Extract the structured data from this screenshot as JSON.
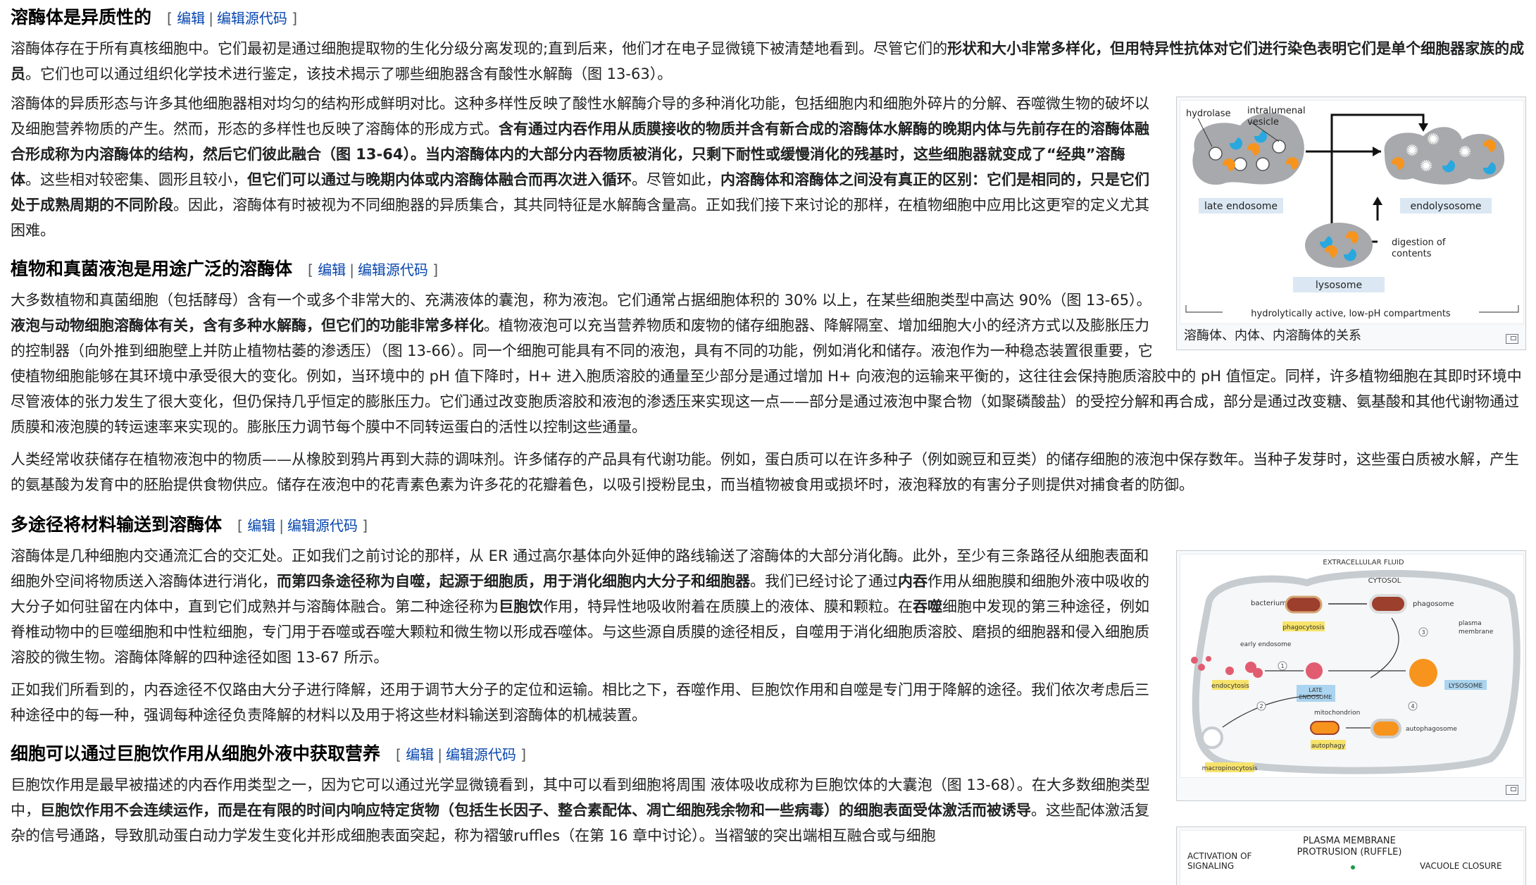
{
  "edit_links": {
    "edit": "编辑",
    "edit_source": "编辑源代码"
  },
  "sections": [
    {
      "title": "溶酶体是异质性的"
    },
    {
      "title": "植物和真菌液泡是用途广泛的溶酶体"
    },
    {
      "title": "多途径将材料输送到溶酶体"
    },
    {
      "title": "细胞可以通过巨胞饮作用从细胞外液中获取营养"
    }
  ],
  "s1": {
    "p1": [
      "溶酶体存在于所有真核细胞中。它们最初是通过细胞提取物的生化分级分离发现的;直到后来，他们才在电子显微镜下被清楚地看到。尽管它们的",
      "形状和大小非常多样化，但用特异性抗体对它们进行染色表明它们是单个细胞器家族的成员",
      "。它们也可以通过组织化学技术进行鉴定，该技术揭示了哪些细胞器含有酸性水解酶（图 13-63）。"
    ],
    "p2": [
      "溶酶体的异质形态与许多其他细胞器相对均匀的结构形成鲜明对比。这种多样性反映了酸性水解酶介导的多种消化功能，包括细胞内和细胞外碎片的分解、吞噬微生物的破坏以及细胞营养物质的产生。然而，形态的多样性也反映了溶酶体的形成方式。",
      "含有通过内吞作用从质膜接收的物质并含有新合成的溶酶体水解酶的晚期内体与先前存在的溶酶体融合形成称为内溶酶体的结构，然后它们彼此融合（图 13-64）。当内溶酶体内的大部分内吞物质被消化，只剩下耐性或缓慢消化的残基时，这些细胞器就变成了“经典”溶酶体",
      "。这些相对较密集、圆形且较小，",
      "但它们可以通过与晚期内体或内溶酶体融合而再次进入循环",
      "。尽管如此，",
      "内溶酶体和溶酶体之间没有真正的区别：它们是相同的，只是它们处于成熟周期的不同阶段",
      "。因此，溶酶体有时被视为不同细胞器的异质集合，其共同特征是水解酶含量高。正如我们接下来讨论的那样，在植物细胞中应用比这更窄的定义尤其困难。"
    ]
  },
  "fig1": {
    "caption": "溶酶体、内体、内溶酶体的关系",
    "labels": {
      "hydrolase": "hydrolase",
      "vesicle1": "intralumenal",
      "vesicle2": "vesicle",
      "late_endosome": "late endosome",
      "endolysosome": "endolysosome",
      "lysosome": "lysosome",
      "digestion1": "digestion of",
      "digestion2": "contents",
      "bottom": "hydrolytically active, low-pH compartments"
    },
    "colors": {
      "compartment": "#a7a9ac",
      "hydrolase_blue": "#29a8e0",
      "hydrolase_orange": "#f7941d",
      "label_bg": "#dbe8f3"
    }
  },
  "s2": {
    "p1": [
      "大多数植物和真菌细胞（包括酵母）含有一个或多个非常大的、充满液体的囊泡，称为液泡。它们通常占据细胞体积的 30% 以上，在某些细胞类型中高达 90%（图 13-65）。",
      "液泡与动物细胞溶酶体有关，含有多种水解酶，但它们的功能非常多样化",
      "。植物液泡可以充当营养物质和废物的储存细胞器、降解隔室、增加细胞大小的经济方式以及膨胀压力的控制器（向外推到细胞壁上并防止植物枯萎的渗透压）（图 13-66）。同一个细胞可能具有不同的液泡，具有不同的功能，例如消化和储存。液泡作为一种稳态装置很重要，它使植物细胞能够在其环境中承受很大的变化。例如，当环境中的 pH 值下降时，H+ 进入胞质溶胶的通量至少部分是通过增加 H+ 向液泡的运输来平衡的，这往往会保持胞质溶胶中的 pH 值恒定。同样，许多植物细胞在其即时环境中尽管液体的张力发生了很大变化，但仍保持几乎恒定的膨胀压力。它们通过改变胞质溶胶和液泡的渗透压来实现这一点——部分是通过液泡中聚合物（如聚磷酸盐）的受控分解和再合成，部分是通过改变糖、氨基酸和其他代谢物通过质膜和液泡膜的转运速率来实现的。膨胀压力调节每个膜中不同转运蛋白的活性以控制这些通量。"
    ],
    "p2": "人类经常收获储存在植物液泡中的物质——从橡胶到鸦片再到大蒜的调味剂。许多储存的产品具有代谢功能。例如，蛋白质可以在许多种子（例如豌豆和豆类）的储存细胞的液泡中保存数年。当种子发芽时，这些蛋白质被水解，产生的氨基酸为发育中的胚胎提供食物供应。储存在液泡中的花青素色素为许多花的花瓣着色，以吸引授粉昆虫，而当植物被食用或损坏时，液泡释放的有害分子则提供对捕食者的防御。"
  },
  "fig2": {
    "labels": {
      "extracellular": "EXTRACELLULAR FLUID",
      "cytosol": "CYTOSOL",
      "bacterium": "bacterium",
      "phagosome": "phagosome",
      "phagocytosis": "phagocytosis",
      "plasma1": "plasma",
      "plasma2": "membrane",
      "early_endosome": "early endosome",
      "endocytosis": "endocytosis",
      "late1": "LATE",
      "late2": "ENDOSOME",
      "lysosome": "LYSOSOME",
      "mitochondrion": "mitochondrion",
      "autophagy": "autophagy",
      "autophagosome": "autophagosome",
      "macropinocytosis": "macropinocytosis",
      "n1": "1",
      "n2": "2",
      "n3": "3",
      "n4": "4"
    },
    "colors": {
      "membrane": "#c7ccd1",
      "label_yellow": "#f7e36b",
      "label_blue": "#aad4ef",
      "lysosome": "#f7941d",
      "phagosome": "#9c3f2d"
    }
  },
  "s3": {
    "p1": [
      "溶酶体是几种细胞内交通流汇合的交汇处。正如我们之前讨论的那样，从 ER 通过高尔基体向外延伸的路线输送了溶酶体的大部分消化酶。此外，至少有三条路径从细胞表面和细胞外空间将物质送入溶酶体进行消化，",
      "而第四条途径称为自噬，起源于细胞质，用于消化细胞内大分子和细胞器",
      "。我们已经讨论了通过",
      "内吞",
      "作用从细胞膜和细胞外液中吸收的大分子如何驻留在内体中，直到它们成熟并与溶酶体融合。第二种途径称为",
      "巨胞饮",
      "作用，特异性地吸收附着在质膜上的液体、膜和颗粒。在",
      "吞噬",
      "细胞中发现的第三种途径，例如脊椎动物中的巨噬细胞和中性粒细胞，专门用于吞噬或吞噬大颗粒和微生物以形成吞噬体。与这些源自质膜的途径相反，自噬用于消化细胞质溶胶、磨损的细胞器和侵入细胞质溶胶的微生物。溶酶体降解的四种途径如图 13-67 所示。"
    ],
    "p2": "正如我们所看到的，内吞途径不仅路由大分子进行降解，还用于调节大分子的定位和运输。相比之下，吞噬作用、巨胞饮作用和自噬是专门用于降解的途径。我们依次考虑后三种途径中的每一种，强调每种途径负责降解的材料以及用于将这些材料输送到溶酶体的机械装置。"
  },
  "s4": {
    "p1": [
      "巨胞饮作用是最早被描述的内吞作用类型之一，因为它可以通过光学显微镜看到，其中可以看到细胞将周围 液体吸收成称为巨胞饮体的大囊泡（图 13-68）。在大多数细胞类型中，",
      "巨胞饮作用不会连续运作，而是在有限的时间内响应特定货物（包括生长因子、整合素配体、凋亡细胞残余物和一些病毒）的细胞表面受体激活而被诱导",
      "。这些配体激活复杂的信号通路，导致肌动蛋白动力学发生变化并形成细胞表面突起，称为褶皱ruffles（在第 16 章中讨论）。当褶皱的突出端相互融合或与细胞"
    ]
  },
  "fig3": {
    "labels": {
      "title1": "PLASMA MEMBRANE",
      "title2": "PROTRUSION (RUFFLE)",
      "left1": "ACTIVATION OF",
      "left2": "SIGNALING",
      "right1": "VACUOLE CLOSURE"
    }
  }
}
